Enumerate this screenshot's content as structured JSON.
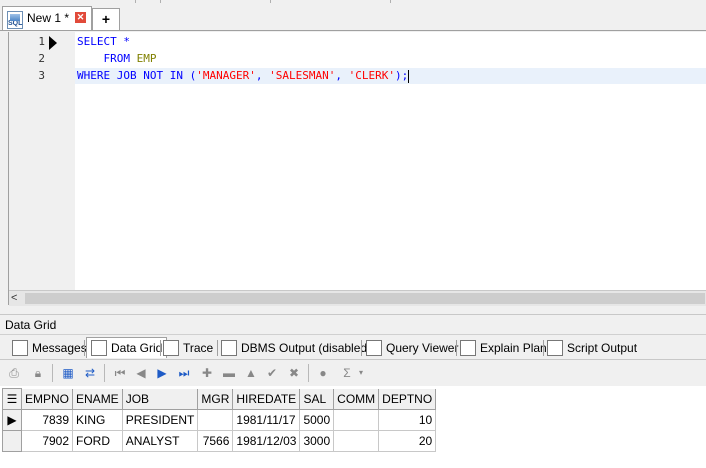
{
  "tabs": {
    "doc_tab_label": "New 1 *",
    "add_tab_symbol": "+"
  },
  "editor": {
    "line_numbers": [
      "1",
      "2",
      "3"
    ],
    "line1": {
      "kw1": "SELECT",
      "rest": " *"
    },
    "line2": {
      "indent": "    ",
      "kw": "FROM",
      "table": "EMP"
    },
    "line3": {
      "kw1": "WHERE",
      "col": "JOB",
      "kw2": "NOT",
      "kw3": "IN",
      "open": " (",
      "s1": "'MANAGER'",
      "s2": "'SALESMAN'",
      "s3": "'CLERK'",
      "close": ");",
      "comma": ", "
    }
  },
  "panel": {
    "title": "Data Grid",
    "tabs": [
      "Messages",
      "Data Grid",
      "Trace",
      "DBMS Output (disabled)",
      "Query Viewer",
      "Explain Plan",
      "Script Output"
    ]
  },
  "grid": {
    "columns": [
      "EMPNO",
      "ENAME",
      "JOB",
      "MGR",
      "HIREDATE",
      "SAL",
      "COMM",
      "DEPTNO"
    ],
    "rows": [
      {
        "EMPNO": "7839",
        "ENAME": "KING",
        "JOB": "PRESIDENT",
        "MGR": "",
        "HIREDATE": "1981/11/17",
        "SAL": "5000",
        "COMM": "",
        "DEPTNO": "10"
      },
      {
        "EMPNO": "7902",
        "ENAME": "FORD",
        "JOB": "ANALYST",
        "MGR": "7566",
        "HIREDATE": "1981/12/03",
        "SAL": "3000",
        "COMM": "",
        "DEPTNO": "20"
      }
    ]
  },
  "colors": {
    "keyword": "#0000ff",
    "identifier": "#808000",
    "string": "#ff0000",
    "current_line": "#e9f1fb"
  }
}
